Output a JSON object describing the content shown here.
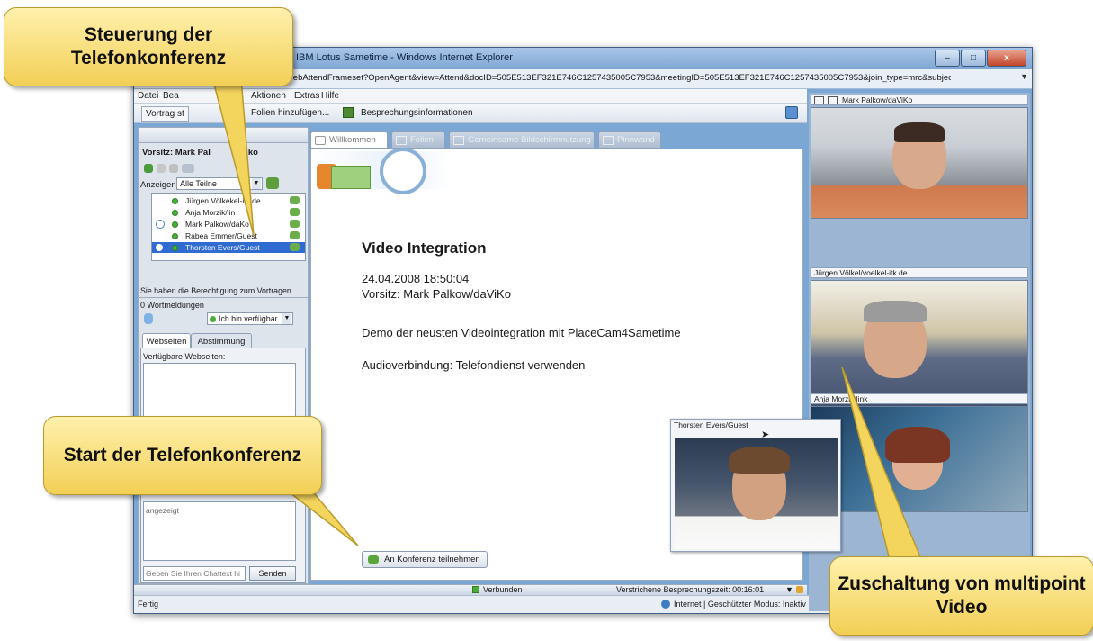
{
  "window": {
    "title": "IBM Lotus Sametime - Windows Internet Explorer",
    "address": "WebAttendFrameset?OpenAgent&view=Attend&docID=505E513EF321E746C1257435005C7953&meetingID=505E513EF321E746C1257435005C7953&join_type=mrc&subject=Video%20Integration&"
  },
  "menu": [
    "Datei",
    "Bea",
    "Aktionen",
    "Extras",
    "Hilfe"
  ],
  "toolbar": {
    "present_label": "Vortrag st",
    "add_slides_label": "Folien hinzufügen...",
    "meeting_info_label": "Besprechungsinformationen"
  },
  "left": {
    "chair": "Vorsitz: Mark Pal",
    "chair_suffix": "ko",
    "show_label": "Anzeigen",
    "show_value": "Alle Teilne",
    "participants": [
      "Jürgen Völke",
      "Anja Morzik/lin",
      "Mark Palkow/da",
      "Rabea Emmer/Guest",
      "Thorsten Evers/Guest"
    ],
    "participant_suffixes": [
      "kel-itk.de",
      "",
      "Ko",
      "",
      ""
    ],
    "permission_text": "Sie haben die Berechtigung zum Vortragen",
    "hand_count": "0 Wortmeldungen",
    "status_value": "Ich bin verfügbar",
    "tabs": [
      "Webseiten",
      "Abstimmung"
    ],
    "webpages_label": "Verfügbare Webseiten:",
    "chat_text": "angezeigt",
    "chat_placeholder": "Geben Sie Ihren Chattext hi",
    "send_label": "Senden"
  },
  "main_tabs": [
    "Willkommen",
    "Folien",
    "Gemeinsame Bildschirmnutzung",
    "Pinnwand"
  ],
  "meeting": {
    "title": "Video Integration",
    "datetime": "24.04.2008 18:50:04",
    "chair": "Vorsitz: Mark Palkow/daViKo",
    "description": "Demo der neusten Videointegration mit PlaceCam4Sametime",
    "audio": "Audioverbindung: Telefondienst verwenden",
    "join_button": "An Konferenz teilnehmen"
  },
  "videos": [
    {
      "name": "Mark Palkow/daViKo"
    },
    {
      "name": "Jürgen Völkel/voelkel-itk.de"
    },
    {
      "name": "Anja Morzik/link"
    }
  ],
  "floating_video": {
    "name": "Thorsten Evers/Guest"
  },
  "bottom": {
    "connected": "Verbunden",
    "elapsed": "Verstrichene Besprechungszeit: 00:16:01"
  },
  "status": {
    "left": "Fertig",
    "zone": "Internet | Geschützter Modus: Inaktiv"
  },
  "callouts": {
    "control": "Steuerung der Telefonkonferenz",
    "start": "Start der Telefonkonferenz",
    "multipoint": "Zuschaltung von multipoint Video"
  },
  "colors": {
    "callout": "#f6d76a",
    "selection": "#2f6bd1",
    "online": "#4cae3a"
  }
}
